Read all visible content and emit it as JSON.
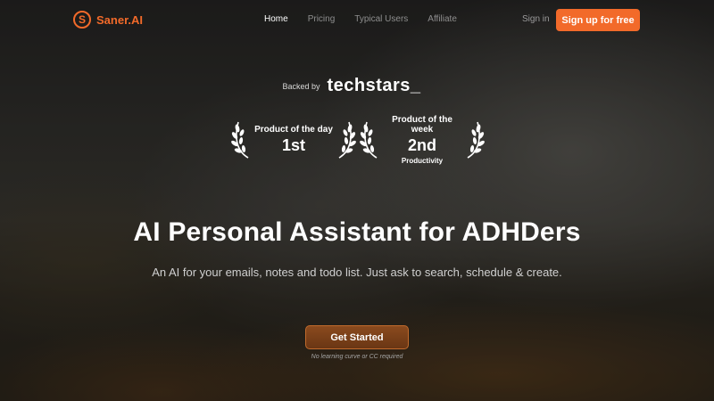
{
  "brand": {
    "name": "Saner.AI",
    "logo_glyph": "S",
    "accent_color": "#f26a2a"
  },
  "nav": {
    "links": [
      {
        "label": "Home",
        "active": true
      },
      {
        "label": "Pricing",
        "active": false
      },
      {
        "label": "Typical Users",
        "active": false
      },
      {
        "label": "Affiliate",
        "active": false
      }
    ],
    "signin_label": "Sign in",
    "signup_label": "Sign up for free"
  },
  "backed": {
    "label": "Backed by",
    "brand": "techstars_"
  },
  "awards": [
    {
      "title": "Product of the day",
      "rank": "1st",
      "sub": ""
    },
    {
      "title": "Product of the week",
      "rank": "2nd",
      "sub": "Productivity"
    }
  ],
  "hero": {
    "headline": "AI Personal Assistant for ADHDers",
    "subhead": "An AI for your emails, notes and todo list. Just ask to search, schedule & create.",
    "cta_label": "Get Started",
    "cta_note": "No learning curve or CC required"
  }
}
